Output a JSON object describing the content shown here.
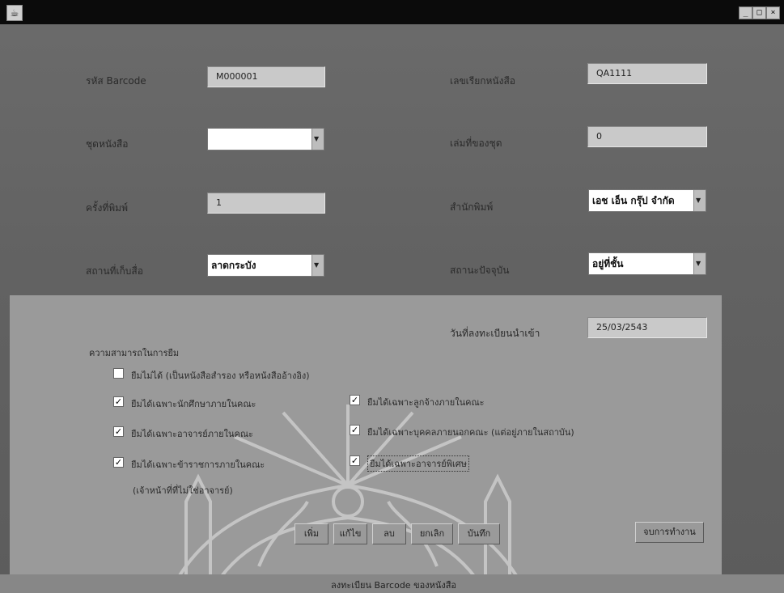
{
  "window": {
    "title": "",
    "controls": [
      "minimize",
      "maximize",
      "close"
    ]
  },
  "form": {
    "barcode": {
      "label": "รหัส Barcode",
      "value": "M000001"
    },
    "call_number": {
      "label": "เลขเรียกหนังสือ",
      "value": "QA1111"
    },
    "book_set": {
      "label": "ชุดหนังสือ",
      "value": ""
    },
    "volume_in_set": {
      "label": "เล่มที่ของชุด",
      "value": "0"
    },
    "edition": {
      "label": "ครั้งที่พิมพ์",
      "value": "1"
    },
    "publisher": {
      "label": "สำนักพิมพ์",
      "value": "เอช เอ็น กรุ๊ป จำกัด"
    },
    "location": {
      "label": "สถานที่เก็บสื่อ",
      "value": "ลาดกระบัง"
    },
    "status": {
      "label": "สถานะปัจจุบัน",
      "value": "อยู่ที่ชั้น"
    },
    "register_date": {
      "label": "วันที่ลงทะเบียนนำเข้า",
      "value": "25/03/2543"
    }
  },
  "borrow": {
    "heading": "ความสามารถในการยืม",
    "options": [
      {
        "label": "ยืมไม่ได้ (เป็นหนังสือสำรอง หรือหนังสืออ้างอิง)",
        "checked": false
      },
      {
        "label": "ยืมได้เฉพาะนักศึกษาภายในคณะ",
        "checked": true
      },
      {
        "label": "ยืมได้เฉพาะลูกจ้างภายในคณะ",
        "checked": true
      },
      {
        "label": "ยืมได้เฉพาะอาจารย์ภายในคณะ",
        "checked": true
      },
      {
        "label": "ยืมได้เฉพาะบุคคลภายนอกคณะ (แต่อยู่ภายในสถาบัน)",
        "checked": true
      },
      {
        "label": "ยืมได้เฉพาะข้าราชการภายในคณะ",
        "checked": true
      },
      {
        "label": "ยืมได้เฉพาะอาจารย์พิเศษ",
        "checked": true
      }
    ],
    "note": "(เจ้าหน้าที่ที่ไม่ใช่อาจารย์)"
  },
  "buttons": {
    "add": "เพิ่ม",
    "edit": "แก้ไข",
    "delete": "ลบ",
    "cancel": "ยกเลิก",
    "save": "บันทึก",
    "exit": "จบการทำงาน"
  },
  "status_bar": {
    "text": "ลงทะเบียน Barcode ของหนังสือ"
  },
  "colors": {
    "titlebar": "#0b0b0b",
    "form_bg": "#636363",
    "panel_bg": "#9a9a9a",
    "field_bg": "#c9c9c9"
  }
}
